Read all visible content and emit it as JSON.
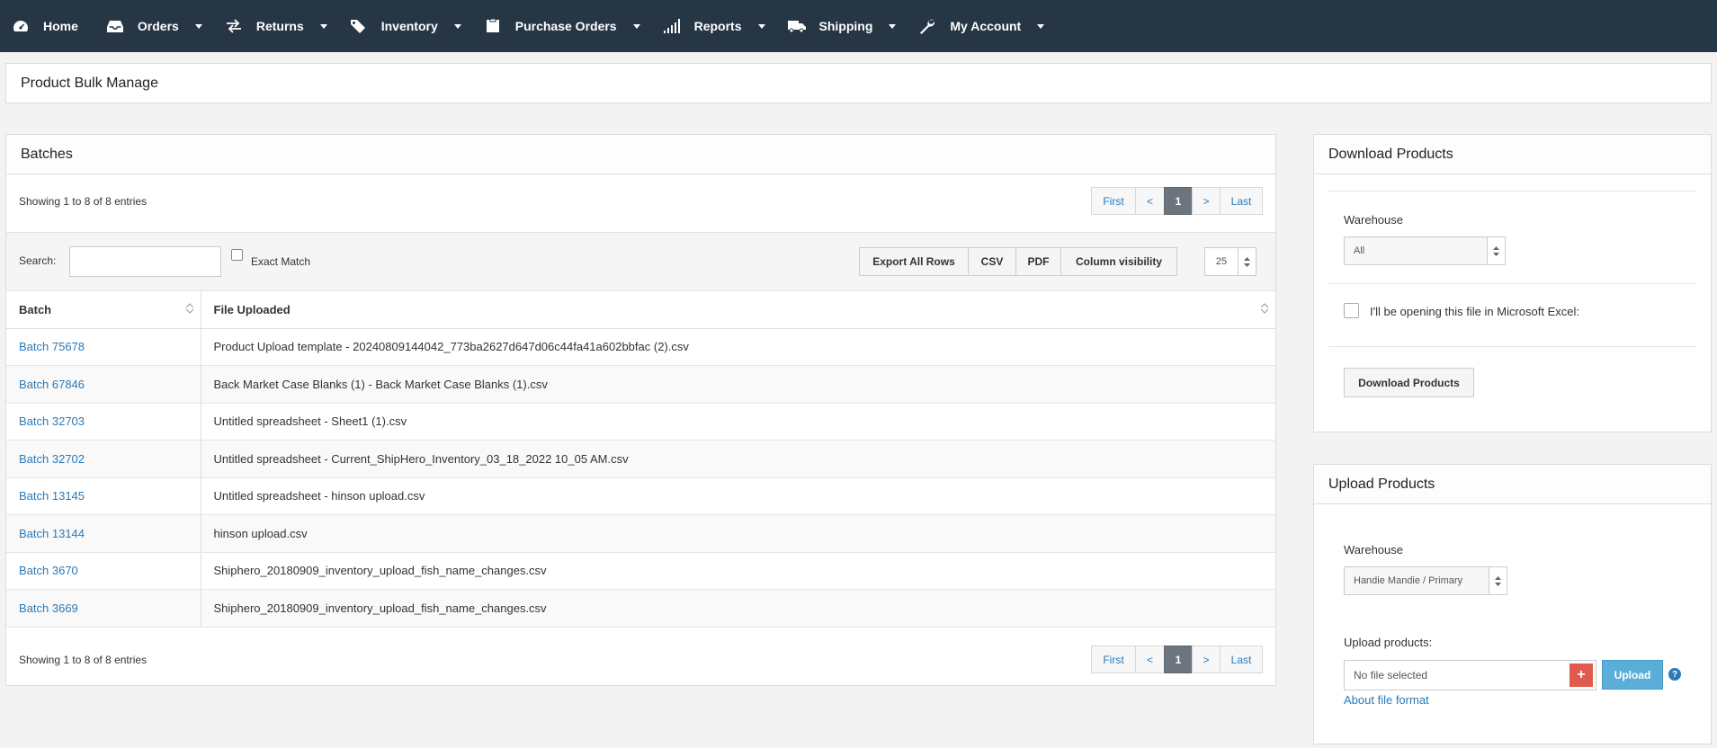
{
  "nav": {
    "items": [
      {
        "label": "Home",
        "icon": "dashboard-icon",
        "caret": false
      },
      {
        "label": "Orders",
        "icon": "inbox-icon",
        "caret": true
      },
      {
        "label": "Returns",
        "icon": "exchange-icon",
        "caret": true
      },
      {
        "label": "Inventory",
        "icon": "tags-icon",
        "caret": true
      },
      {
        "label": "Purchase Orders",
        "icon": "clipboard-icon",
        "caret": true
      },
      {
        "label": "Reports",
        "icon": "signal-icon",
        "caret": true
      },
      {
        "label": "Shipping",
        "icon": "truck-icon",
        "caret": true
      },
      {
        "label": "My Account",
        "icon": "wrench-icon",
        "caret": true
      }
    ]
  },
  "page": {
    "title": "Product Bulk Manage"
  },
  "batches": {
    "title": "Batches",
    "info_top": "Showing 1 to 8 of 8 entries",
    "info_bottom": "Showing 1 to 8 of 8 entries",
    "pager": {
      "first": "First",
      "prev": "<",
      "page": "1",
      "next": ">",
      "last": "Last"
    },
    "search_label": "Search:",
    "search_value": "",
    "exact_match_label": "Exact Match",
    "buttons": {
      "export": "Export All Rows",
      "csv": "CSV",
      "pdf": "PDF",
      "colvis": "Column visibility"
    },
    "page_length": "25",
    "columns": [
      "Batch",
      "File Uploaded"
    ],
    "rows": [
      {
        "batch": "Batch 75678",
        "file": "Product Upload template - 20240809144042_773ba2627d647d06c44fa41a602bbfac (2).csv"
      },
      {
        "batch": "Batch 67846",
        "file": "Back Market Case Blanks (1) - Back Market Case Blanks (1).csv"
      },
      {
        "batch": "Batch 32703",
        "file": "Untitled spreadsheet - Sheet1 (1).csv"
      },
      {
        "batch": "Batch 32702",
        "file": "Untitled spreadsheet - Current_ShipHero_Inventory_03_18_2022 10_05 AM.csv"
      },
      {
        "batch": "Batch 13145",
        "file": "Untitled spreadsheet - hinson upload.csv"
      },
      {
        "batch": "Batch 13144",
        "file": "hinson upload.csv"
      },
      {
        "batch": "Batch 3670",
        "file": "Shiphero_20180909_inventory_upload_fish_name_changes.csv"
      },
      {
        "batch": "Batch 3669",
        "file": "Shiphero_20180909_inventory_upload_fish_name_changes.csv"
      }
    ]
  },
  "download": {
    "title": "Download Products",
    "warehouse_label": "Warehouse",
    "warehouse_value": "All",
    "excel_label": "I'll be opening this file in Microsoft Excel:",
    "button": "Download Products"
  },
  "upload": {
    "title": "Upload Products",
    "warehouse_label": "Warehouse",
    "warehouse_value": "Handie Mandie / Primary",
    "upload_label": "Upload products:",
    "file_placeholder": "No file selected",
    "add_button": "+",
    "upload_button": "Upload",
    "about_link": "About file format"
  },
  "colors": {
    "nav_bg": "#263645",
    "link": "#2a7ab8",
    "active_page": "#6c757d",
    "add_button": "#e05a4e",
    "upload_button": "#5aaed9"
  }
}
